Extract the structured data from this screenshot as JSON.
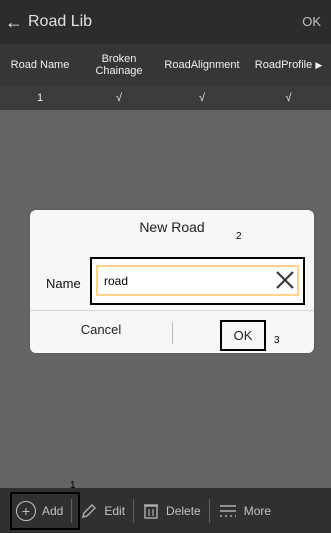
{
  "topbar": {
    "back_icon": "←",
    "title": "Road Lib",
    "ok_label": "OK"
  },
  "table": {
    "headers": [
      "Road Name",
      "Broken Chainage",
      "RoadAlignment",
      "RoadProfile"
    ],
    "more_icon": "▶",
    "rows": [
      [
        "1",
        "√",
        "√",
        "√"
      ]
    ]
  },
  "toolbar": {
    "add_label": "Add",
    "edit_label": "Edit",
    "delete_label": "Delete",
    "more_label": "More"
  },
  "dialog": {
    "title": "New Road",
    "name_label": "Name",
    "name_value": "road",
    "cancel_label": "Cancel",
    "ok_label": "OK"
  },
  "annotations": {
    "n1": "1",
    "n2": "2",
    "n3": "3"
  }
}
